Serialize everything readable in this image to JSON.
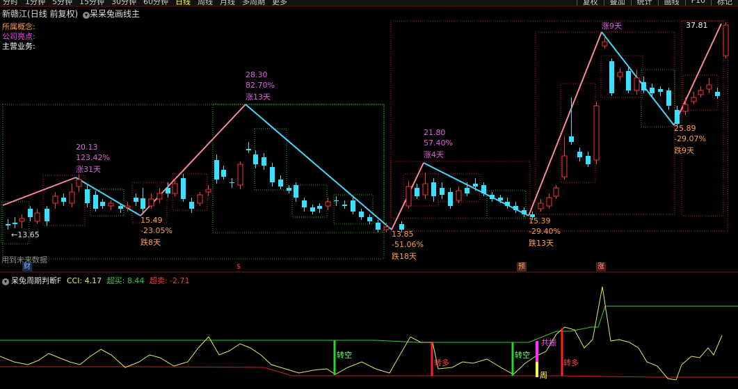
{
  "toolbar": {
    "periods": [
      "分时",
      "1分钟",
      "5分钟",
      "15分钟",
      "30分钟",
      "60分钟",
      "日线",
      "周线",
      "月线",
      "多周期",
      "更多"
    ],
    "active_period": "日线",
    "right_buttons": [
      "复权",
      "叠加",
      "统计",
      "画线",
      "F10",
      "标记"
    ]
  },
  "header": {
    "stock": "新赣江",
    "mode": "(日线 前复权)",
    "indicator_icon": "chevron-down-icon",
    "indicator": "呆呆兔画线主"
  },
  "info_rows": [
    {
      "label": "所属概念:",
      "color": "#ff9933"
    },
    {
      "label": "公司亮点:",
      "color": "#ff44ff"
    },
    {
      "label": "主营业务:",
      "color": "#ffffff"
    }
  ],
  "annotations": {
    "peak1": {
      "price": "20.13",
      "pct": "123.42%",
      "days": "涨31天"
    },
    "trough1": {
      "price": "15.49",
      "pct": "-23.05%",
      "days": "跌8天"
    },
    "peak2": {
      "price": "28.30",
      "pct": "82.70%",
      "days": "涨13天"
    },
    "trough2": {
      "price": "13.85",
      "pct": "-51.06%",
      "days": "跌18天"
    },
    "peak3": {
      "price": "21.80",
      "pct": "57.40%",
      "days": "涨4天"
    },
    "trough3": {
      "price": "15.39",
      "pct": "-29.40%",
      "days": "跌13天"
    },
    "peak4": {
      "days": "涨9天"
    },
    "trough4": {
      "price": "25.89",
      "pct": "-29.07%",
      "days": "跌9天"
    },
    "last_price": "37.81",
    "low_marker": "13.65",
    "future_note": "用到未来数据"
  },
  "event_marks": [
    {
      "label": "财",
      "color": "#7fb4ff",
      "bg": "#1b2b4a"
    },
    {
      "label": "$",
      "color": "#ff4040",
      "bg": "#000000"
    },
    {
      "label": "预",
      "color": "#ff9966",
      "bg": "#4a2a1a"
    },
    {
      "label": "涨",
      "color": "#ff9999",
      "bg": "#4a1a1a"
    }
  ],
  "sub_indicator": {
    "name": "呆兔周期判断F",
    "cci_label": "CCI:",
    "cci_value": "4.17",
    "overbuy_label": "超买:",
    "overbuy_value": "8.44",
    "oversell_label": "超卖:",
    "oversell_value": "-2.71",
    "signals": [
      {
        "text": "转空",
        "color": "#66ff66"
      },
      {
        "text": "转多",
        "color": "#ff4444"
      },
      {
        "text": "转空",
        "color": "#66ff66"
      },
      {
        "text": "共振",
        "color": "#ff44ff"
      },
      {
        "text": "周",
        "color": "#ffff44"
      },
      {
        "text": "转多",
        "color": "#ff4444"
      }
    ]
  },
  "colors": {
    "up": "#ff3333",
    "down": "#39e0ff",
    "rise_line": "#ff8899",
    "fall_line": "#44d8ff",
    "box_red": "#cc2222",
    "box_green": "#22aa22",
    "cci_line": "#e8e860",
    "overbuy_line": "#33cc33",
    "oversell_line": "#cc2222"
  }
}
